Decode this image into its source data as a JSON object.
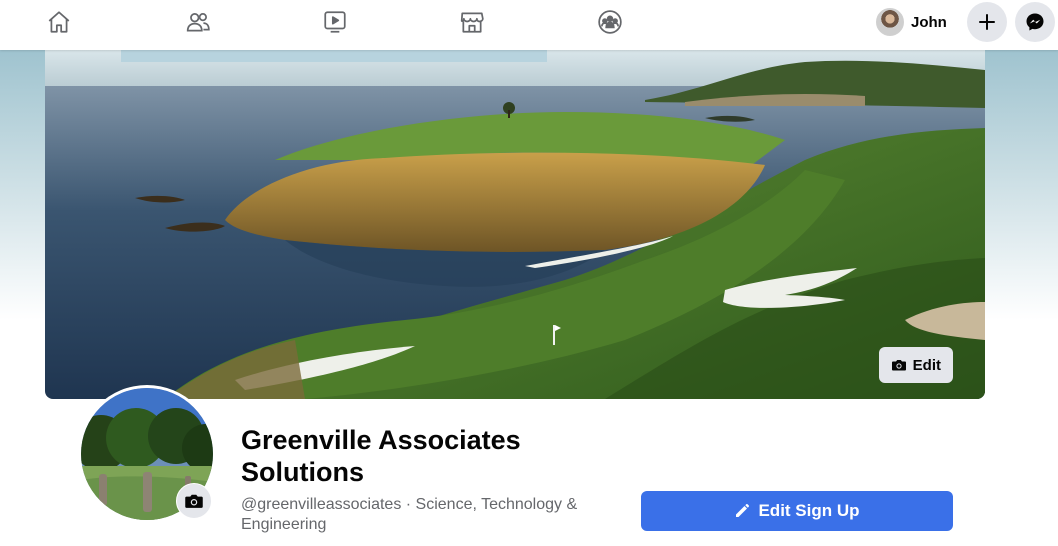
{
  "nav": {
    "icons": [
      "home-icon",
      "friends-icon",
      "watch-icon",
      "marketplace-icon",
      "groups-icon"
    ],
    "user_name": "John",
    "create_icon": "plus-icon",
    "messenger_icon": "messenger-icon"
  },
  "cover": {
    "edit_label": "Edit"
  },
  "page": {
    "name_line1": "Greenville Associates",
    "name_line2": "Solutions",
    "handle": "@greenvilleassociates",
    "separator": " · ",
    "category": "Science, Technology & Engineering"
  },
  "actions": {
    "edit_signup_label": "Edit Sign Up"
  },
  "colors": {
    "primary_button": "#3a70e8",
    "icon_gray": "#65676b",
    "secondary_button": "#e4e6eb"
  }
}
